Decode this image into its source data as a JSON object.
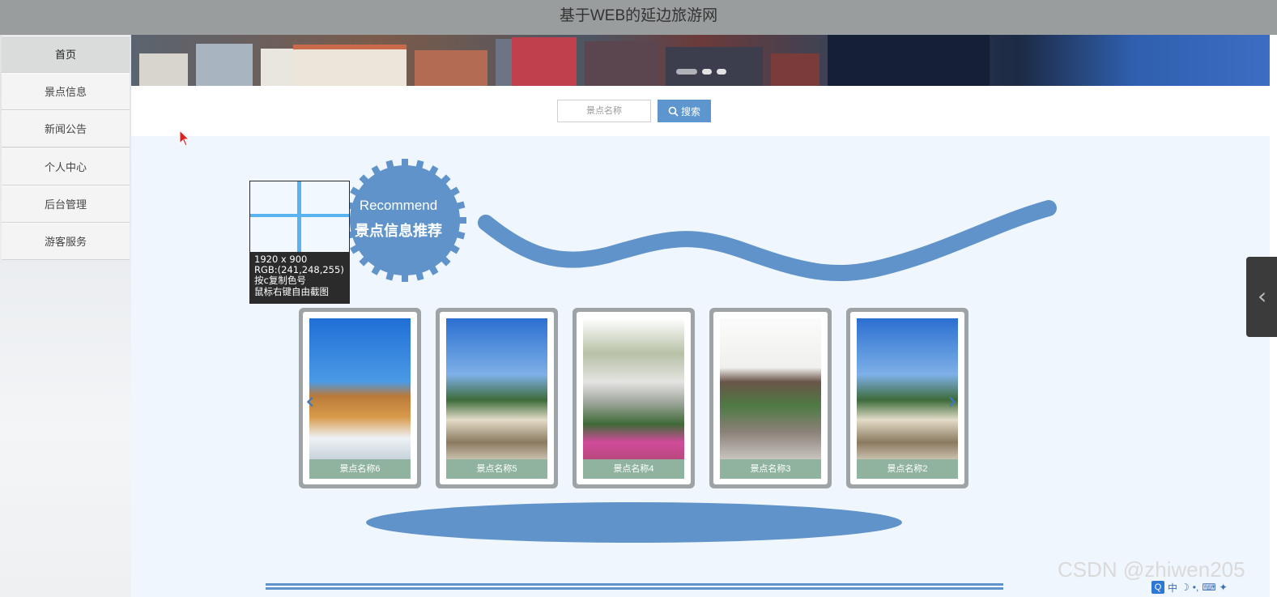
{
  "header": {
    "title": "基于WEB的延边旅游网"
  },
  "sidebar": {
    "items": [
      {
        "label": "首页",
        "active": true
      },
      {
        "label": "景点信息"
      },
      {
        "label": "新闻公告"
      },
      {
        "label": "个人中心"
      },
      {
        "label": "后台管理"
      },
      {
        "label": "游客服务"
      }
    ]
  },
  "search": {
    "placeholder": "景点名称",
    "button_label": "搜索",
    "button_icon": "search-icon"
  },
  "recommend": {
    "title_en": "Recommend",
    "title_cn": "景点信息推荐"
  },
  "screenshot_tool": {
    "lines": [
      "1920 x 900",
      "RGB:(241,248,255)",
      "按c复制色号",
      "鼠标右键自由截图"
    ]
  },
  "cards": [
    {
      "caption": "景点名称6"
    },
    {
      "caption": "景点名称5"
    },
    {
      "caption": "景点名称4"
    },
    {
      "caption": "景点名称3"
    },
    {
      "caption": "景点名称2"
    }
  ],
  "carousel": {
    "prev_icon": "chevron-left-icon",
    "next_icon": "chevron-right-icon"
  },
  "watermark": "CSDN @zhiwen205",
  "ime": {
    "label": "中"
  },
  "colors": {
    "accent": "#5f93c9",
    "topbar": "#9a9d9e",
    "content_bg": "#f0f6fd",
    "caption_bg": "#8fb39f"
  }
}
